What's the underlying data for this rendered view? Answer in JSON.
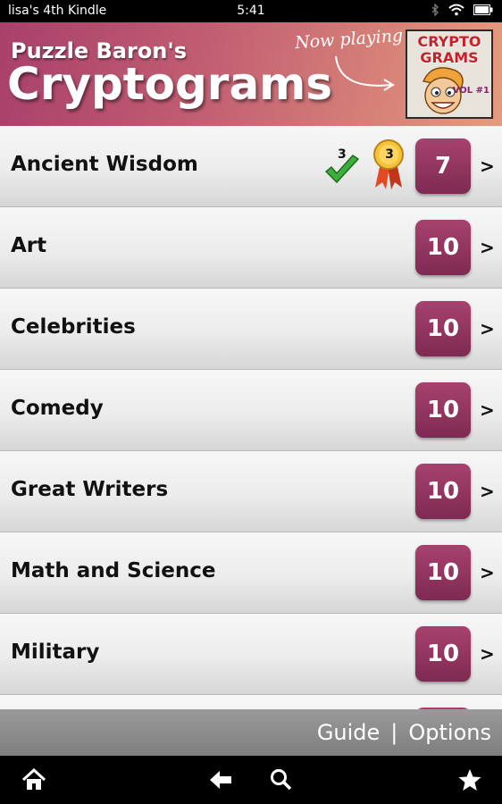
{
  "status_bar": {
    "device_name": "lisa's 4th Kindle",
    "time": "5:41",
    "icons": [
      "bluetooth-icon",
      "wifi-icon",
      "battery-icon"
    ]
  },
  "header": {
    "brand_sub": "Puzzle Baron's",
    "brand_main": "Cryptograms",
    "now_playing": "Now playing",
    "cover_title_1": "CRYPTO",
    "cover_title_2": "GRAMS",
    "cover_vol": "VOL #1"
  },
  "categories": [
    {
      "title": "Ancient Wisdom",
      "count": "7",
      "check_count": "3",
      "medal_count": "3"
    },
    {
      "title": "Art",
      "count": "10"
    },
    {
      "title": "Celebrities",
      "count": "10"
    },
    {
      "title": "Comedy",
      "count": "10"
    },
    {
      "title": "Great Writers",
      "count": "10"
    },
    {
      "title": "Math and Science",
      "count": "10"
    },
    {
      "title": "Military",
      "count": "10"
    }
  ],
  "chevron": ">",
  "footer": {
    "guide": "Guide",
    "separator": "|",
    "options": "Options"
  },
  "nav_bar": {
    "icons": [
      "home-icon",
      "back-arrow-icon",
      "search-icon",
      "favorites-star-icon"
    ]
  },
  "colors": {
    "accent": "#8f3460",
    "banner_start": "#a8406a",
    "banner_end": "#e59b7c"
  }
}
